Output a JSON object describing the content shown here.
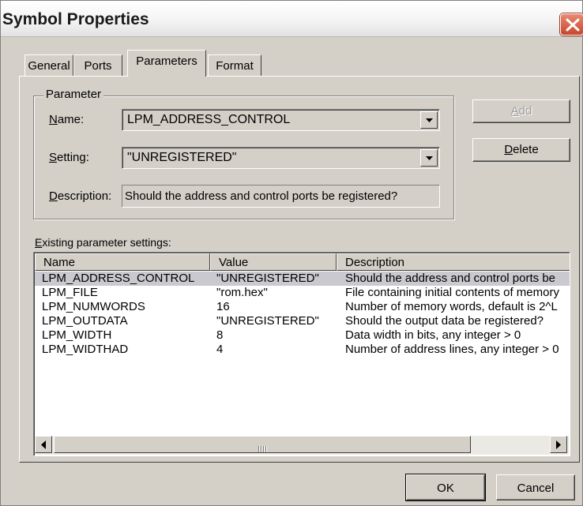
{
  "window": {
    "title": "Symbol Properties",
    "close_icon": "close-x-icon"
  },
  "tabs": [
    {
      "label": "General",
      "active": false
    },
    {
      "label": "Ports",
      "active": false
    },
    {
      "label": "Parameters",
      "active": true
    },
    {
      "label": "Format",
      "active": false
    }
  ],
  "parameter_group": {
    "label": "Parameter",
    "name_label": "Name:",
    "name_value": "LPM_ADDRESS_CONTROL",
    "setting_label": "Setting:",
    "setting_value": "\"UNREGISTERED\"",
    "description_label": "Description:",
    "description_value": "Should the address and control ports be registered?"
  },
  "buttons": {
    "add": "Add",
    "delete": "Delete",
    "ok": "OK",
    "cancel": "Cancel"
  },
  "existing": {
    "label": "Existing parameter settings:",
    "columns": [
      "Name",
      "Value",
      "Description"
    ],
    "rows": [
      {
        "name": "LPM_ADDRESS_CONTROL",
        "value": "\"UNREGISTERED\"",
        "description": "Should the address and control ports be",
        "selected": true
      },
      {
        "name": "LPM_FILE",
        "value": "\"rom.hex\"",
        "description": "File containing initial contents of memory",
        "selected": false
      },
      {
        "name": "LPM_NUMWORDS",
        "value": "16",
        "description": "Number of memory words, default is 2^L",
        "selected": false
      },
      {
        "name": "LPM_OUTDATA",
        "value": "\"UNREGISTERED\"",
        "description": "Should the output data be registered?",
        "selected": false
      },
      {
        "name": "LPM_WIDTH",
        "value": "8",
        "description": "Data width in bits, any integer > 0",
        "selected": false
      },
      {
        "name": "LPM_WIDTHAD",
        "value": "4",
        "description": "Number of address lines, any integer > 0",
        "selected": false
      }
    ]
  },
  "colors": {
    "dialog_face": "#d4d0c8",
    "selection": "#c9c9cf",
    "close_button": "#c8462c"
  }
}
